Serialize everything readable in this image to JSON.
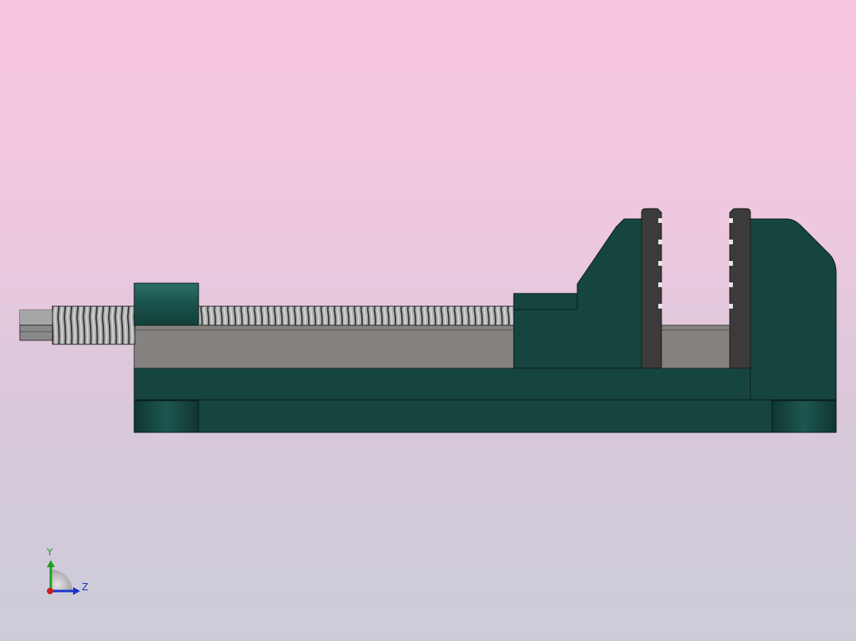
{
  "viewport": {
    "model": "machine-vise",
    "view_orientation": "right",
    "colors": {
      "body": "#164540",
      "body_highlight": "#2a6a62",
      "jaw_plate": "#3b3b3b",
      "rail": "#868280",
      "screw": "#9a9a9a",
      "edge": "#0a1a18"
    }
  },
  "triad": {
    "y_label": "Y",
    "z_label": "Z",
    "colors": {
      "y": "#1e9e1e",
      "z": "#1a35c8",
      "x": "#c81e1e"
    }
  }
}
